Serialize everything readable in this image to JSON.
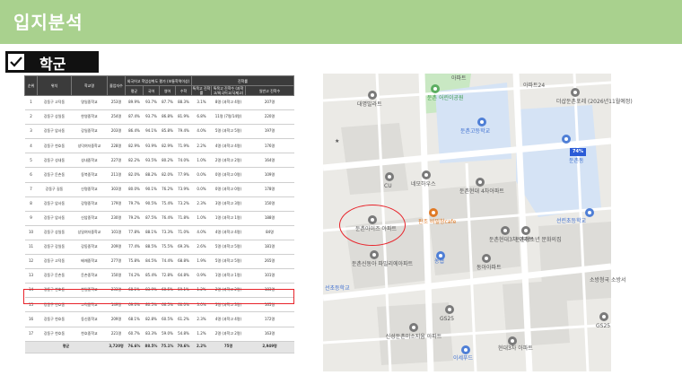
{
  "page": {
    "title": "입지분석"
  },
  "section": {
    "title": "학군"
  },
  "table": {
    "headers": {
      "no": "순위",
      "region": "위치",
      "school": "학교명",
      "grads": "졸업자수",
      "group_rate": "외국어고 학업성취도 평가 (보통학력이상)",
      "avg": "평균",
      "kor": "국어",
      "eng": "영어",
      "math": "수학",
      "sp_low": "특목고 진학률",
      "group_adv": "진학률",
      "sp_count": "특목고 진학수 (과학고/외국어고/국제고)",
      "adv_count": "일반고 진학수"
    },
    "rows": [
      {
        "no": "1",
        "region": "강동구 고덕동",
        "school": "명일중학교",
        "grads": "253명",
        "avg": "89.9%",
        "kor": "93.7%",
        "eng": "87.7%",
        "math": "88.3%",
        "sp": "3.1%",
        "spc": "8명 (과학고 4명)",
        "adv": "207명"
      },
      {
        "no": "2",
        "region": "강동구 상일동",
        "school": "한영중학교",
        "grads": "254명",
        "avg": "87.4%",
        "kor": "93.7%",
        "eng": "86.8%",
        "math": "81.9%",
        "sp": "6.8%",
        "spc": "11명 (7명/14명)",
        "adv": "220명"
      },
      {
        "no": "3",
        "region": "강동구 암사동",
        "school": "강일중학교",
        "grads": "203명",
        "avg": "86.4%",
        "kor": "94.1%",
        "eng": "85.8%",
        "math": "79.4%",
        "sp": "4.0%",
        "spc": "5명 (과학고 5명)",
        "adv": "197명"
      },
      {
        "no": "4",
        "region": "강동구 천호동",
        "school": "성덕여자중학교",
        "grads": "228명",
        "avg": "82.9%",
        "kor": "93.9%",
        "eng": "82.9%",
        "math": "71.9%",
        "sp": "2.2%",
        "spc": "4명 (과학고 4명)",
        "adv": "176명"
      },
      {
        "no": "5",
        "region": "강동구 성내동",
        "school": "성내중학교",
        "grads": "227명",
        "avg": "82.2%",
        "kor": "93.5%",
        "eng": "80.2%",
        "math": "74.0%",
        "sp": "1.0%",
        "spc": "2명 (과학고 2명)",
        "adv": "164명"
      },
      {
        "no": "6",
        "region": "강동구 둔촌동",
        "school": "동북중학교",
        "grads": "211명",
        "avg": "82.0%",
        "kor": "88.2%",
        "eng": "82.0%",
        "math": "77.9%",
        "sp": "0.0%",
        "spc": "0명 (과학고 0명)",
        "adv": "109명"
      },
      {
        "no": "7",
        "region": "강동구 길동",
        "school": "신명중학교",
        "grads": "303명",
        "avg": "80.0%",
        "kor": "90.1%",
        "eng": "76.2%",
        "math": "73.9%",
        "sp": "0.0%",
        "spc": "0명 (과학고 0명)",
        "adv": "178명"
      },
      {
        "no": "8",
        "region": "강동구 암사동",
        "school": "강명중학교",
        "grads": "179명",
        "avg": "79.7%",
        "kor": "90.5%",
        "eng": "75.4%",
        "math": "73.2%",
        "sp": "2.3%",
        "spc": "3명 (과학고 3명)",
        "adv": "150명"
      },
      {
        "no": "9",
        "region": "강동구 암사동",
        "school": "신암중학교",
        "grads": "230명",
        "avg": "79.2%",
        "kor": "87.5%",
        "eng": "76.4%",
        "math": "71.8%",
        "sp": "1.0%",
        "spc": "1명 (과학고 1명)",
        "adv": "188명"
      },
      {
        "no": "10",
        "region": "강동구 상일동",
        "school": "상일여자중학교",
        "grads": "101명",
        "avg": "77.8%",
        "kor": "88.1%",
        "eng": "73.3%",
        "math": "71.0%",
        "sp": "4.0%",
        "spc": "4명 (과학고 4명)",
        "adv": "84명"
      },
      {
        "no": "11",
        "region": "강동구 강일동",
        "school": "강동중학교",
        "grads": "209명",
        "avg": "77.4%",
        "kor": "88.5%",
        "eng": "75.5%",
        "math": "69.3%",
        "sp": "2.6%",
        "spc": "5명 (과학고 5명)",
        "adv": "181명"
      },
      {
        "no": "12",
        "region": "강동구 고덕동",
        "school": "배재중학교",
        "grads": "277명",
        "avg": "75.8%",
        "kor": "84.5%",
        "eng": "74.4%",
        "math": "68.8%",
        "sp": "1.9%",
        "spc": "5명 (과학고 5명)",
        "adv": "265명"
      },
      {
        "no": "13",
        "region": "강동구 둔촌동",
        "school": "둔촌중학교",
        "grads": "150명",
        "avg": "74.2%",
        "kor": "85.4%",
        "eng": "72.8%",
        "math": "64.8%",
        "sp": "0.9%",
        "spc": "1명 (과학고 1명)",
        "adv": "101명"
      },
      {
        "no": "14",
        "region": "강동구 천호동",
        "school": "천일중학교",
        "grads": "233명",
        "avg": "68.1%",
        "kor": "83.9%",
        "eng": "60.5%",
        "math": "59.1%",
        "sp": "1.2%",
        "spc": "2명 (과학고 2명)",
        "adv": "183명"
      },
      {
        "no": "15",
        "region": "강동구 천호동",
        "school": "고덕중학교",
        "grads": "149명",
        "avg": "69.0%",
        "kor": "80.5%",
        "eng": "66.5%",
        "math": "60.0%",
        "sp": "3.0%",
        "spc": "3명 (과학고 3명)",
        "adv": "165명"
      },
      {
        "no": "16",
        "region": "강동구 천호동",
        "school": "동신중학교",
        "grads": "209명",
        "avg": "68.1%",
        "kor": "82.8%",
        "eng": "60.5%",
        "math": "61.2%",
        "sp": "2.3%",
        "spc": "4명 (과학고 4명)",
        "adv": "172명"
      },
      {
        "no": "17",
        "region": "강동구 천호동",
        "school": "천호중학교",
        "grads": "221명",
        "avg": "60.7%",
        "kor": "83.3%",
        "eng": "59.0%",
        "math": "54.8%",
        "sp": "1.2%",
        "spc": "2명 (과학고 2명)",
        "adv": "163명"
      }
    ],
    "total": {
      "label": "평균",
      "grads": "3,720명",
      "avg": "76.6%",
      "kor": "88.5%",
      "eng": "75.1%",
      "math": "70.6%",
      "sp": "2.2%",
      "spc": "75명",
      "adv": "2,949명"
    }
  },
  "map": {
    "labels": {
      "apt1": "아파트",
      "apt24": "아파트24",
      "dh1": "더샵둔촌포레 (2026년11월예정)",
      "daemyung": "대명빌라트",
      "park": "둔촌 어린이공원",
      "dunchon_high": "둔촌고등학교",
      "dunchon_dong": "둔촌동",
      "cu": "CU",
      "nemo": "네모하우스",
      "hyundai4": "둔촌현대 4차아파트",
      "iz": "둔촌아이즈 아파트",
      "cafe": "판조 비밀창cafe",
      "seonrin": "선린초등학교",
      "hyundai3": "둔촌현대3차 아파트",
      "munhwa": "둔촌청소년 문화의집",
      "paragon": "둔촌신동아 파밀리에아파트",
      "nonghyup": "농협",
      "dong_apt": "동아아파트",
      "gs1": "GS25",
      "sobang": "소방청국 소방서",
      "gs2": "GS25",
      "sinsung": "신성둔촌미소지움 아파트",
      "hyeondae3b": "현대3차 아파트",
      "mart": "이세푸드",
      "seodong": "선초등학교",
      "badge": "74%"
    }
  }
}
